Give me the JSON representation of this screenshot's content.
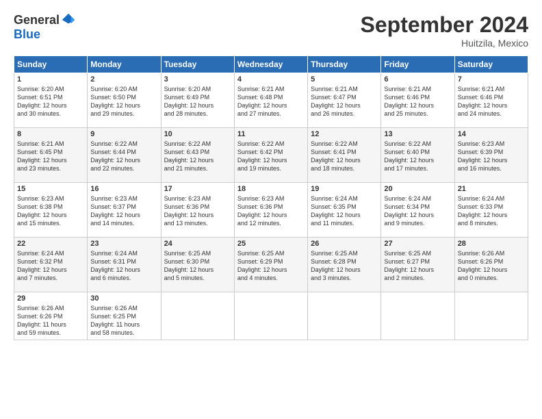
{
  "header": {
    "logo_general": "General",
    "logo_blue": "Blue",
    "month_title": "September 2024",
    "location": "Huitzila, Mexico"
  },
  "days_of_week": [
    "Sunday",
    "Monday",
    "Tuesday",
    "Wednesday",
    "Thursday",
    "Friday",
    "Saturday"
  ],
  "weeks": [
    [
      {
        "day": "1",
        "info": "Sunrise: 6:20 AM\nSunset: 6:51 PM\nDaylight: 12 hours\nand 30 minutes."
      },
      {
        "day": "2",
        "info": "Sunrise: 6:20 AM\nSunset: 6:50 PM\nDaylight: 12 hours\nand 29 minutes."
      },
      {
        "day": "3",
        "info": "Sunrise: 6:20 AM\nSunset: 6:49 PM\nDaylight: 12 hours\nand 28 minutes."
      },
      {
        "day": "4",
        "info": "Sunrise: 6:21 AM\nSunset: 6:48 PM\nDaylight: 12 hours\nand 27 minutes."
      },
      {
        "day": "5",
        "info": "Sunrise: 6:21 AM\nSunset: 6:47 PM\nDaylight: 12 hours\nand 26 minutes."
      },
      {
        "day": "6",
        "info": "Sunrise: 6:21 AM\nSunset: 6:46 PM\nDaylight: 12 hours\nand 25 minutes."
      },
      {
        "day": "7",
        "info": "Sunrise: 6:21 AM\nSunset: 6:46 PM\nDaylight: 12 hours\nand 24 minutes."
      }
    ],
    [
      {
        "day": "8",
        "info": "Sunrise: 6:21 AM\nSunset: 6:45 PM\nDaylight: 12 hours\nand 23 minutes."
      },
      {
        "day": "9",
        "info": "Sunrise: 6:22 AM\nSunset: 6:44 PM\nDaylight: 12 hours\nand 22 minutes."
      },
      {
        "day": "10",
        "info": "Sunrise: 6:22 AM\nSunset: 6:43 PM\nDaylight: 12 hours\nand 21 minutes."
      },
      {
        "day": "11",
        "info": "Sunrise: 6:22 AM\nSunset: 6:42 PM\nDaylight: 12 hours\nand 19 minutes."
      },
      {
        "day": "12",
        "info": "Sunrise: 6:22 AM\nSunset: 6:41 PM\nDaylight: 12 hours\nand 18 minutes."
      },
      {
        "day": "13",
        "info": "Sunrise: 6:22 AM\nSunset: 6:40 PM\nDaylight: 12 hours\nand 17 minutes."
      },
      {
        "day": "14",
        "info": "Sunrise: 6:23 AM\nSunset: 6:39 PM\nDaylight: 12 hours\nand 16 minutes."
      }
    ],
    [
      {
        "day": "15",
        "info": "Sunrise: 6:23 AM\nSunset: 6:38 PM\nDaylight: 12 hours\nand 15 minutes."
      },
      {
        "day": "16",
        "info": "Sunrise: 6:23 AM\nSunset: 6:37 PM\nDaylight: 12 hours\nand 14 minutes."
      },
      {
        "day": "17",
        "info": "Sunrise: 6:23 AM\nSunset: 6:36 PM\nDaylight: 12 hours\nand 13 minutes."
      },
      {
        "day": "18",
        "info": "Sunrise: 6:23 AM\nSunset: 6:36 PM\nDaylight: 12 hours\nand 12 minutes."
      },
      {
        "day": "19",
        "info": "Sunrise: 6:24 AM\nSunset: 6:35 PM\nDaylight: 12 hours\nand 11 minutes."
      },
      {
        "day": "20",
        "info": "Sunrise: 6:24 AM\nSunset: 6:34 PM\nDaylight: 12 hours\nand 9 minutes."
      },
      {
        "day": "21",
        "info": "Sunrise: 6:24 AM\nSunset: 6:33 PM\nDaylight: 12 hours\nand 8 minutes."
      }
    ],
    [
      {
        "day": "22",
        "info": "Sunrise: 6:24 AM\nSunset: 6:32 PM\nDaylight: 12 hours\nand 7 minutes."
      },
      {
        "day": "23",
        "info": "Sunrise: 6:24 AM\nSunset: 6:31 PM\nDaylight: 12 hours\nand 6 minutes."
      },
      {
        "day": "24",
        "info": "Sunrise: 6:25 AM\nSunset: 6:30 PM\nDaylight: 12 hours\nand 5 minutes."
      },
      {
        "day": "25",
        "info": "Sunrise: 6:25 AM\nSunset: 6:29 PM\nDaylight: 12 hours\nand 4 minutes."
      },
      {
        "day": "26",
        "info": "Sunrise: 6:25 AM\nSunset: 6:28 PM\nDaylight: 12 hours\nand 3 minutes."
      },
      {
        "day": "27",
        "info": "Sunrise: 6:25 AM\nSunset: 6:27 PM\nDaylight: 12 hours\nand 2 minutes."
      },
      {
        "day": "28",
        "info": "Sunrise: 6:26 AM\nSunset: 6:26 PM\nDaylight: 12 hours\nand 0 minutes."
      }
    ],
    [
      {
        "day": "29",
        "info": "Sunrise: 6:26 AM\nSunset: 6:26 PM\nDaylight: 11 hours\nand 59 minutes."
      },
      {
        "day": "30",
        "info": "Sunrise: 6:26 AM\nSunset: 6:25 PM\nDaylight: 11 hours\nand 58 minutes."
      },
      {
        "day": "",
        "info": ""
      },
      {
        "day": "",
        "info": ""
      },
      {
        "day": "",
        "info": ""
      },
      {
        "day": "",
        "info": ""
      },
      {
        "day": "",
        "info": ""
      }
    ]
  ]
}
